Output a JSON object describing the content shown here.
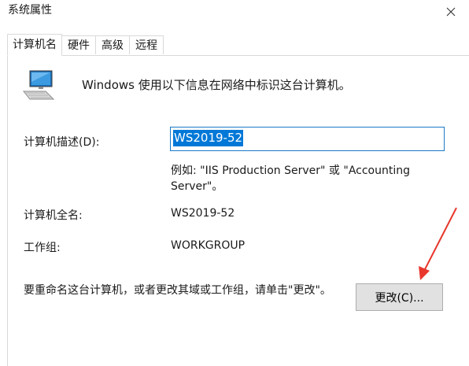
{
  "window": {
    "title": "系统属性"
  },
  "tabs": [
    {
      "label": "计算机名",
      "active": true
    },
    {
      "label": "硬件",
      "active": false
    },
    {
      "label": "高级",
      "active": false
    },
    {
      "label": "远程",
      "active": false
    }
  ],
  "intro": {
    "icon": "computer-icon",
    "text": "Windows 使用以下信息在网络中标识这台计算机。"
  },
  "description": {
    "label": "计算机描述(D):",
    "value": "WS2019-52",
    "example": "例如: \"IIS Production Server\" 或 \"Accounting Server\"。"
  },
  "full_name": {
    "label": "计算机全名:",
    "value": "WS2019-52"
  },
  "workgroup": {
    "label": "工作组:",
    "value": "WORKGROUP"
  },
  "rename": {
    "text": "要重命名这台计算机，或者更改其域或工作组，请单击\"更改\"。",
    "button_label": "更改(C)..."
  },
  "colors": {
    "selection": "#0078d7",
    "input_border": "#1979ca",
    "annotation_arrow": "#e8372c",
    "button_bg": "#e1e1e1"
  }
}
